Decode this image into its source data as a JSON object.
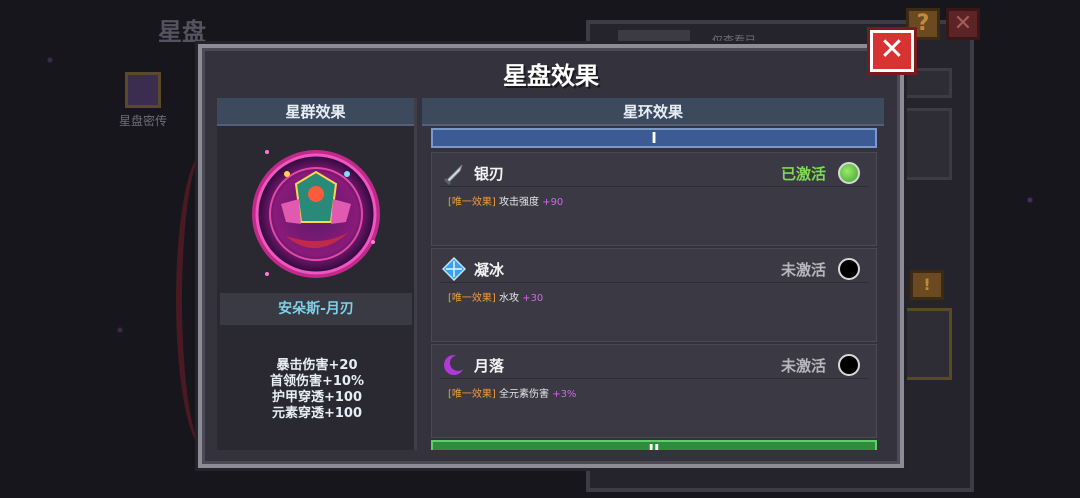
{
  "background": {
    "title": "星盘",
    "side_item_label": "星盘密传",
    "tab_label": "仅查看已",
    "help_icon": "?",
    "close_icon": "✕",
    "warn_icon": "!"
  },
  "modal": {
    "title": "星盘效果",
    "close_label": "✕",
    "left": {
      "header": "星群效果",
      "set_name": "安朵斯-月刃",
      "bonuses": [
        "暴击伤害+20",
        "首领伤害+10%",
        "护甲穿透+100",
        "元素穿透+100"
      ]
    },
    "right": {
      "header": "星环效果",
      "tiers": [
        {
          "label": "I",
          "color": "#3c5a94",
          "effects": [
            {
              "icon": "silver-blade-icon",
              "name": "银刃",
              "status": "已激活",
              "active": true,
              "tag": "[唯一效果]",
              "stat": "攻击强度",
              "value": "+90"
            },
            {
              "icon": "frost-crystal-icon",
              "name": "凝冰",
              "status": "未激活",
              "active": false,
              "tag": "[唯一效果]",
              "stat": "水攻",
              "value": "+30"
            },
            {
              "icon": "crescent-moon-icon",
              "name": "月落",
              "status": "未激活",
              "active": false,
              "tag": "[唯一效果]",
              "stat": "全元素伤害",
              "value": "+3%"
            }
          ]
        },
        {
          "label": "II",
          "color": "#2e8c3c"
        }
      ]
    }
  },
  "colors": {
    "active_status": "#7ed957",
    "inactive_status": "#b6b6bc",
    "tag": "#f29a3c",
    "value": "#d066e8",
    "set_name": "#7fd1e8"
  }
}
